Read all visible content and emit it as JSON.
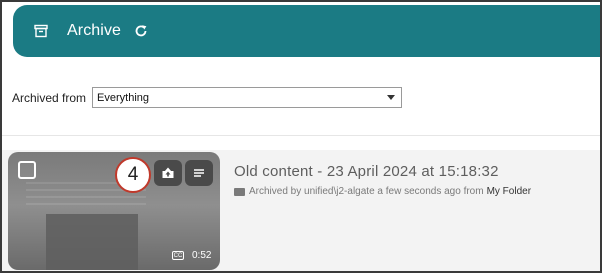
{
  "header": {
    "title": "Archive",
    "icon": "archive-box-icon",
    "refresh_icon": "refresh-icon",
    "background": "#1b7b84"
  },
  "filter": {
    "label": "Archived from",
    "selected": "Everything"
  },
  "item": {
    "title": "Old content - 23 April 2024 at 15:18:32",
    "archived_by_text": "Archived by unified\\j2-algate a few seconds ago from",
    "folder": "My Folder",
    "duration": "0:52",
    "step_badge": "4",
    "caption_label": "CC"
  }
}
